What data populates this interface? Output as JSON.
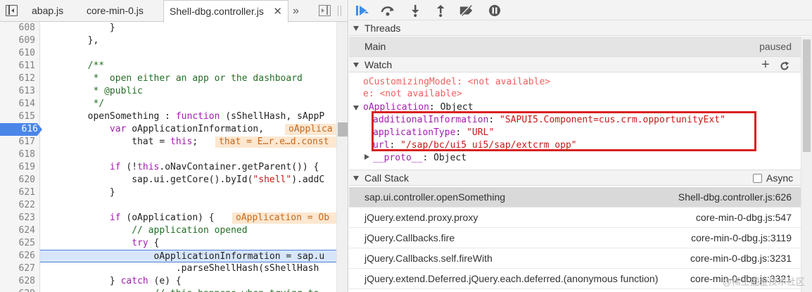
{
  "tabs": [
    {
      "label": "abap.js"
    },
    {
      "label": "core-min-0.js"
    },
    {
      "label": "Shell-dbg.controller.js"
    }
  ],
  "tab_overflow": "»",
  "code_lines": [
    {
      "n": "608",
      "text": "            }"
    },
    {
      "n": "609",
      "text": "        },"
    },
    {
      "n": "610",
      "text": ""
    },
    {
      "n": "611",
      "text": "        /**"
    },
    {
      "n": "612",
      "text": "         *  open either an app or the dashboard"
    },
    {
      "n": "613",
      "text": "         * @public"
    },
    {
      "n": "614",
      "text": "         */"
    },
    {
      "n": "615",
      "text": "        openSomething : function (sShellHash, sAppP"
    },
    {
      "n": "616",
      "text": "            var oApplicationInformation,"
    },
    {
      "n": "617",
      "text": "                that = this;"
    },
    {
      "n": "618",
      "text": ""
    },
    {
      "n": "619",
      "text": "            if (!this.oNavContainer.getParent()) {"
    },
    {
      "n": "620",
      "text": "                sap.ui.getCore().byId(\"shell\").addC"
    },
    {
      "n": "621",
      "text": "            }"
    },
    {
      "n": "622",
      "text": ""
    },
    {
      "n": "623",
      "text": "            if (oApplication) {"
    },
    {
      "n": "624",
      "text": "                // application opened"
    },
    {
      "n": "625",
      "text": "                try {"
    },
    {
      "n": "626",
      "text": "                    oApplicationInformation = sap.u"
    },
    {
      "n": "627",
      "text": "                        .parseShellHash(sShellHash"
    },
    {
      "n": "628",
      "text": "            } catch (e) {"
    },
    {
      "n": "629",
      "text": "                    // this happens when trying to"
    }
  ],
  "inline_values": {
    "l616": "oApplica",
    "l617": "that = E…r.e…d.const",
    "l623": "oApplication = Ob"
  },
  "sections": {
    "threads": "Threads",
    "watch": "Watch",
    "call_stack": "Call Stack",
    "async": "Async"
  },
  "thread": {
    "name": "Main",
    "status": "paused"
  },
  "watch": [
    {
      "name": "oCustomizingModel",
      "value": "<not available>"
    },
    {
      "name": "e",
      "value": "<not available>"
    }
  ],
  "watch_object": {
    "name": "oApplication",
    "type": "Object",
    "props": [
      {
        "key": "additionalInformation",
        "value": "\"SAPUI5.Component=cus.crm.opportunityExt\""
      },
      {
        "key": "applicationType",
        "value": "\"URL\""
      },
      {
        "key": "url",
        "value": "\"/sap/bc/ui5_ui5/sap/extcrm_opp\""
      }
    ],
    "proto_key": "__proto__",
    "proto_value": "Object"
  },
  "call_stack": [
    {
      "fn": "sap.ui.controller.openSomething",
      "loc": "Shell-dbg.controller.js:626"
    },
    {
      "fn": "jQuery.extend.proxy.proxy",
      "loc": "core-min-0-dbg.js:547"
    },
    {
      "fn": "jQuery.Callbacks.fire",
      "loc": "core-min-0-dbg.js:3119"
    },
    {
      "fn": "jQuery.Callbacks.self.fireWith",
      "loc": "core-min-0-dbg.js:3231"
    },
    {
      "fn": "jQuery.extend.Deferred.jQuery.each.deferred.(anonymous function)",
      "loc": "core-min-0-dbg.js:3321"
    }
  ],
  "watermark": "@稀土掘金技术社区",
  "colors": {
    "highlight_line": "#d7e6fb",
    "current_line_border": "#4a7fd0",
    "inline_bg": "#fde7d0",
    "red_box": "#d92020",
    "selected_frame": "#d9d9d9",
    "paused_icon": "#3d8ee8"
  }
}
